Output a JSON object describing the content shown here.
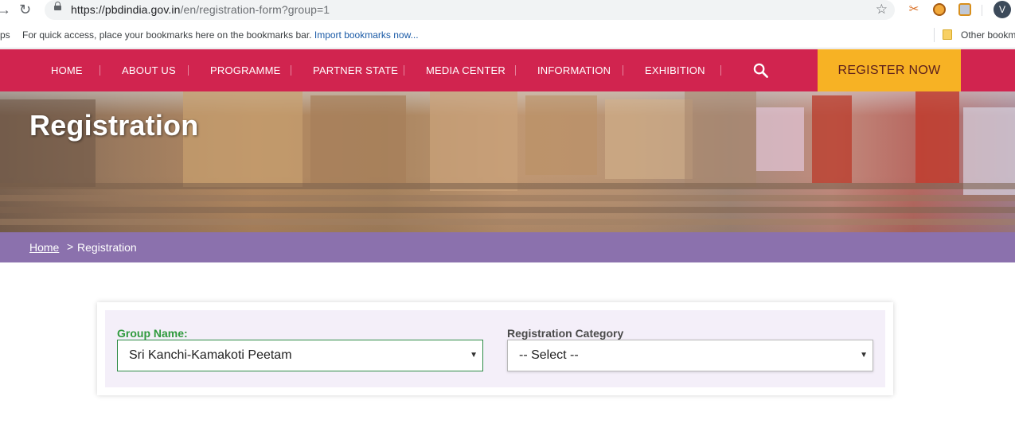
{
  "browser": {
    "url_host": "https://pbdindia.gov.in",
    "url_path": "/en/registration-form?group=1",
    "avatar_letter": "V",
    "bookmarks_apps": "ps",
    "bookmarks_hint": "For quick access, place your bookmarks here on the bookmarks bar.",
    "bookmarks_import": "Import bookmarks now...",
    "bookmarks_other": "Other bookm"
  },
  "nav": {
    "items": [
      {
        "label": "HOME"
      },
      {
        "label": "ABOUT US"
      },
      {
        "label": "PROGRAMME"
      },
      {
        "label": "PARTNER STATE"
      },
      {
        "label": "MEDIA CENTER"
      },
      {
        "label": "INFORMATION"
      },
      {
        "label": "EXHIBITION"
      }
    ],
    "register_label": "REGISTER NOW"
  },
  "banner": {
    "title": "Registration"
  },
  "breadcrumb": {
    "home": "Home",
    "separator": ">",
    "current": "Registration"
  },
  "form": {
    "group_label": "Group Name:",
    "group_value": "Sri Kanchi-Kamakoti Peetam",
    "category_label": "Registration Category",
    "category_value": "-- Select --"
  },
  "colors": {
    "nav_bg": "#d1244f",
    "register_bg": "#f7b224",
    "breadcrumb_bg": "#8b71ad",
    "group_label": "#2f9a3d",
    "card_inner_bg": "#f4eff9"
  }
}
